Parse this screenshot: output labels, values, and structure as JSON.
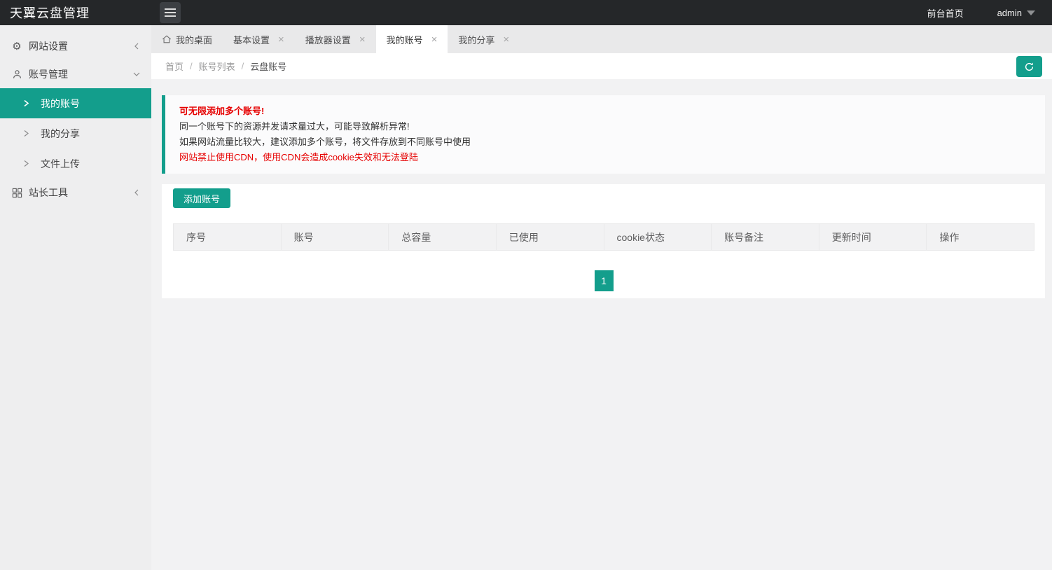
{
  "topbar": {
    "title": "天翼云盘管理",
    "frontpage": "前台首页",
    "username": "admin"
  },
  "sidebar": {
    "items": [
      {
        "label": "网站设置",
        "icon": "gear-icon",
        "state": "collapsed"
      },
      {
        "label": "账号管理",
        "icon": "user-icon",
        "state": "expanded"
      },
      {
        "label": "站长工具",
        "icon": "grid-icon",
        "state": "collapsed"
      }
    ],
    "account_submenu": [
      {
        "label": "我的账号",
        "active": true
      },
      {
        "label": "我的分享",
        "active": false
      },
      {
        "label": "文件上传",
        "active": false
      }
    ]
  },
  "tabs": {
    "close_glyph": "×",
    "items": [
      {
        "label": "我的桌面",
        "icon": "home-icon",
        "closable": false,
        "active": false
      },
      {
        "label": "基本设置",
        "closable": true,
        "active": false
      },
      {
        "label": "播放器设置",
        "closable": true,
        "active": false
      },
      {
        "label": "我的账号",
        "closable": true,
        "active": true
      },
      {
        "label": "我的分享",
        "closable": true,
        "active": false
      }
    ]
  },
  "breadcrumb": {
    "separator": "/",
    "items": [
      "首页",
      "账号列表",
      "云盘账号"
    ]
  },
  "alert": {
    "lines": [
      {
        "text": "可无限添加多个账号!",
        "style": "red-bold"
      },
      {
        "text": "同一个账号下的资源并发请求量过大，可能导致解析异常!",
        "style": "normal"
      },
      {
        "text": "如果网站流量比较大，建议添加多个账号，将文件存放到不同账号中使用",
        "style": "normal"
      },
      {
        "text": "网站禁止使用CDN，使用CDN会造成cookie失效和无法登陆",
        "style": "red"
      }
    ]
  },
  "main": {
    "add_button": "添加账号",
    "table": {
      "headers": [
        "序号",
        "账号",
        "总容量",
        "已使用",
        "cookie状态",
        "账号备注",
        "更新时间",
        "操作"
      ],
      "rows": []
    },
    "pagination": {
      "current": "1"
    }
  },
  "colors": {
    "accent_teal": "#139e8c",
    "alert_red": "#e60000",
    "topbar_bg": "#252729",
    "sidebar_bg": "#eeeeef",
    "tabbar_bg": "#e9e9ea"
  }
}
